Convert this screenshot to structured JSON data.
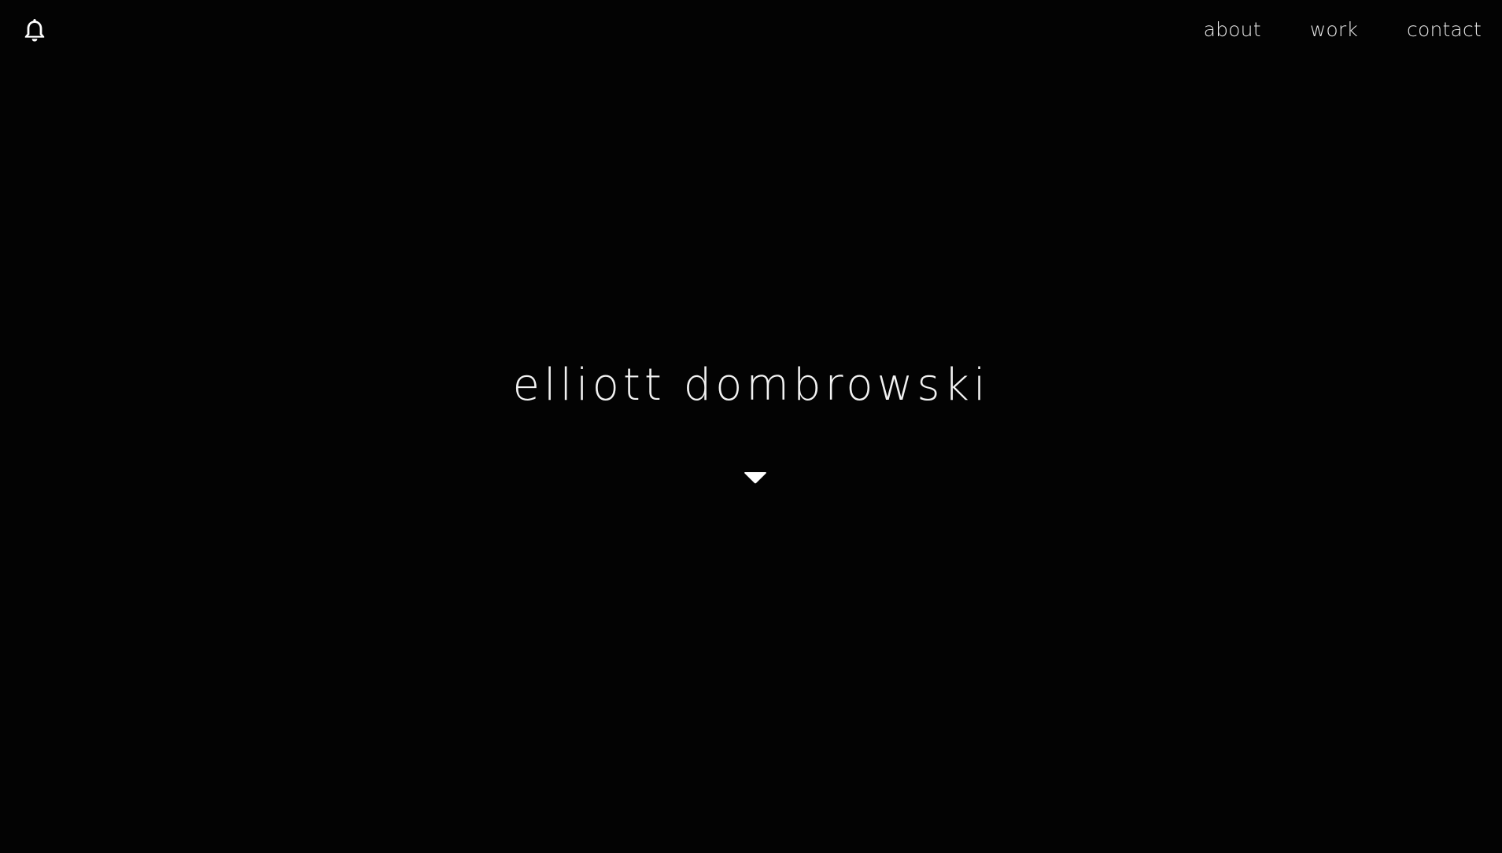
{
  "header": {
    "logo_icon": "bell-icon",
    "nav": {
      "about": "about",
      "work": "work",
      "contact": "contact"
    }
  },
  "hero": {
    "title": "elliott dombrowski",
    "scroll_icon": "chevron-down-icon"
  },
  "colors": {
    "background": "#030303",
    "text": "#f2f2f2"
  }
}
